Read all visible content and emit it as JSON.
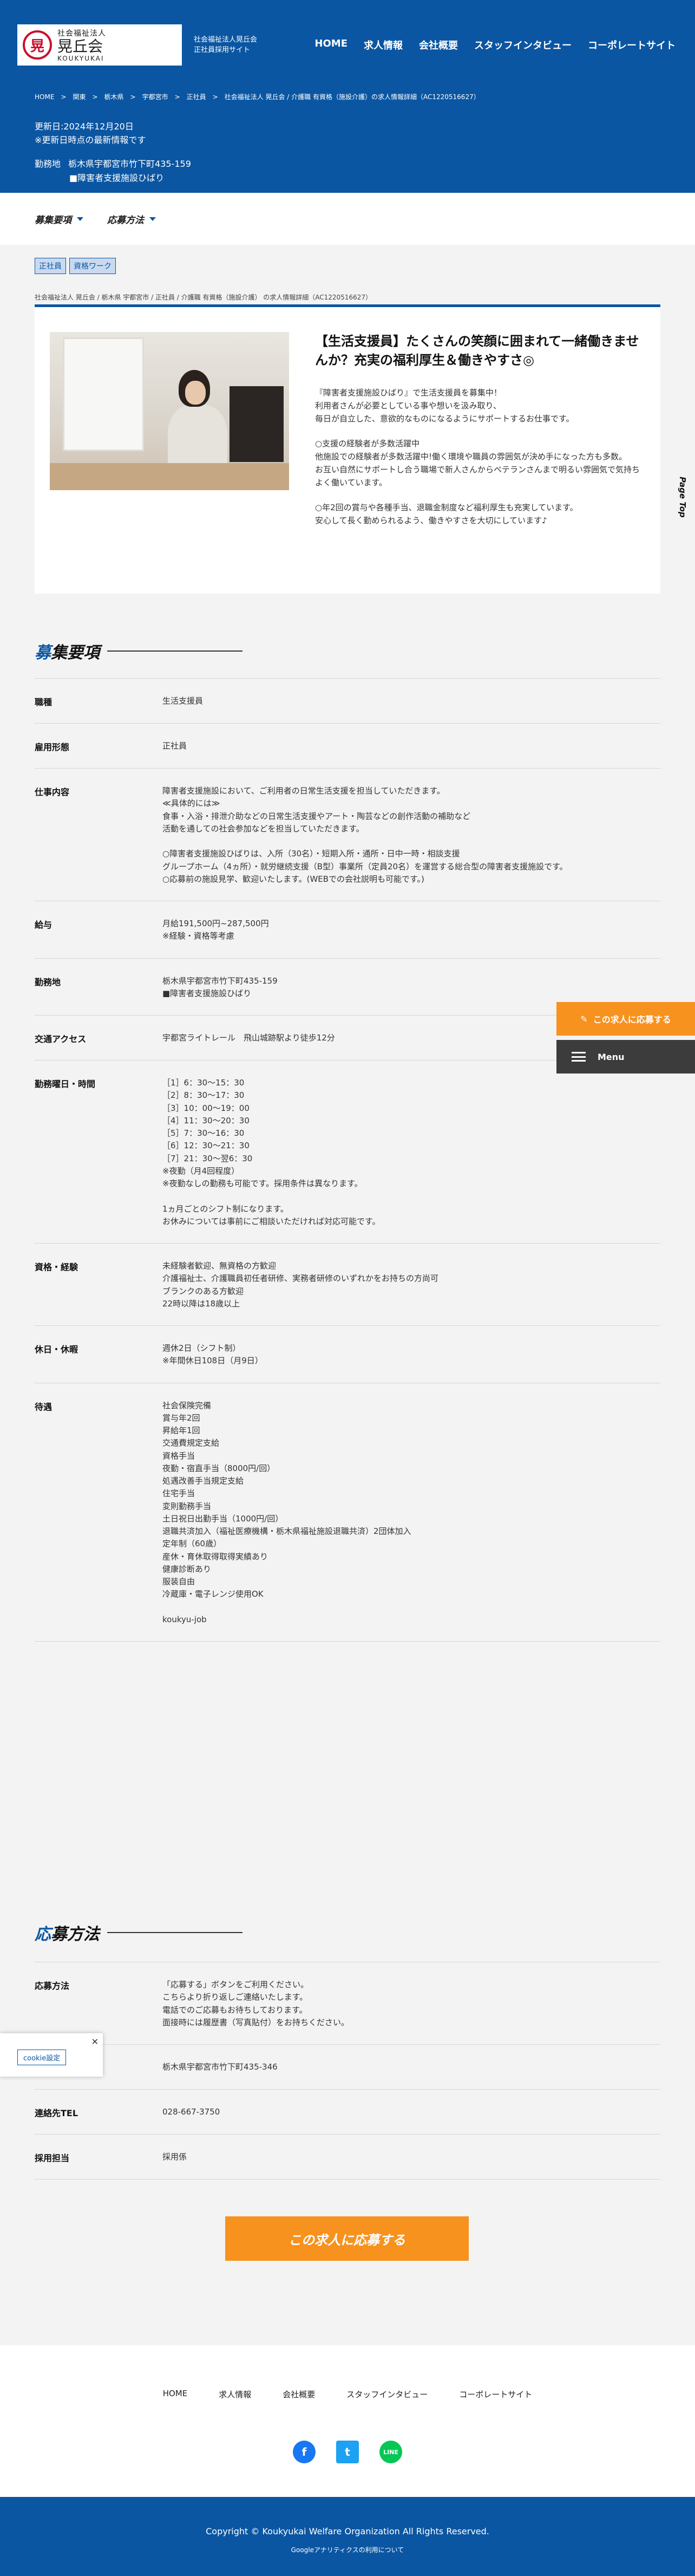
{
  "header": {
    "logo": {
      "mark": "晃",
      "top": "社会福祉法人",
      "main": "晃丘会",
      "sub": "KOUKYUKAI"
    },
    "site_sub": "社会福祉法人晃丘会\n正社員採用サイト",
    "nav": [
      "HOME",
      "求人情報",
      "会社概要",
      "スタッフインタビュー",
      "コーポレートサイト"
    ]
  },
  "breadcrumb_top": "HOME　>　関東　>　栃木県　>　宇都宮市　>　正社員　>　社会福祉法人 晃丘会 / 介護職 有資格（施設介護）の求人情報詳細（AC1220516627）",
  "updated": {
    "date": "更新日:2024年12月20日",
    "note": "※更新日時点の最新情報です"
  },
  "workplace_top": {
    "label": "勤務地",
    "address": "栃木県宇都宮市竹下町435-159",
    "facility": "■障害者支援施設ひばり"
  },
  "tabs": [
    "募集要項",
    "応募方法"
  ],
  "tags": [
    "正社員",
    "資格ワーク"
  ],
  "breadcrumb2": "社会福祉法人 晃丘会 / 栃木県 宇都宮市 / 正社員 / 介護職 有資格（施設介護） の求人情報詳細（AC1220516627）",
  "card": {
    "title": "【生活支援員】たくさんの笑顔に囲まれて一緒働きませんか？充実の福利厚生＆働きやすさ◎",
    "paragraphs": [
      "『障害者支援施設ひばり』で生活支援員を募集中！\n利用者さんが必要としている事や想いを汲み取り、\n毎日が自立した、意欲的なものになるようにサポートするお仕事です。",
      "○支援の経験者が多数活躍中\n他施設での経験者が多数活躍中!働く環境や職員の雰囲気が決め手になった方も多数。\nお互い自然にサポートし合う職場で新人さんからベテランさんまで明るい雰囲気で気持ちよく働いています。",
      "○年2回の賞与や各種手当、退職金制度など福利厚生も充実しています。\n安心して長く勤められるよう、働きやすさを大切にしています♪"
    ]
  },
  "sections": {
    "recruit_title_first": "募",
    "recruit_title_rest": "集要項",
    "apply_title_first": "応",
    "apply_title_rest": "募方法"
  },
  "recruit_rows": [
    {
      "label": "職種",
      "value": "生活支援員"
    },
    {
      "label": "雇用形態",
      "value": "正社員"
    },
    {
      "label": "仕事内容",
      "value": "障害者支援施設において、ご利用者の日常生活支援を担当していただきます。\n≪具体的には≫\n食事・入浴・排泄介助などの日常生活支援やアート・陶芸などの創作活動の補助など\n活動を通しての社会参加などを担当していただきます。\n\n○障害者支援施設ひばりは、入所（30名）・短期入所・通所・日中一時・相談支援\nグループホーム（4ヵ所）・就労継続支援（B型）事業所（定員20名）を運営する総合型の障害者支援施設です。\n○応募前の施設見学、歓迎いたします。(WEBでの会社説明も可能です。)"
    },
    {
      "label": "給与",
      "value": "月給191,500円~287,500円\n※経験・資格等考慮"
    },
    {
      "label": "勤務地",
      "value": "栃木県宇都宮市竹下町435-159\n■障害者支援施設ひばり"
    },
    {
      "label": "交通アクセス",
      "value": "宇都宮ライトレール　飛山城跡駅より徒歩12分"
    },
    {
      "label": "勤務曜日・時間",
      "value": "［1］6：30〜15：30\n［2］8：30〜17：30\n［3］10：00〜19：00\n［4］11：30〜20：30\n［5］7：30〜16：30\n［6］12：30〜21：30\n［7］21：30〜翌6：30\n※夜勤（月4回程度）\n※夜勤なしの勤務も可能です。採用条件は異なります。\n\n1ヵ月ごとのシフト制になります。\nお休みについては事前にご相談いただければ対応可能です。"
    },
    {
      "label": "資格・経験",
      "value": "未経験者歓迎、無資格の方歓迎\n介護福祉士、介護職員初任者研修、実務者研修のいずれかをお持ちの方尚可\nブランクのある方歓迎\n22時以降は18歳以上"
    },
    {
      "label": "休日・休暇",
      "value": "週休2日（シフト制）\n※年間休日108日（月9日）"
    },
    {
      "label": "待遇",
      "value": "社会保険完備\n賞与年2回\n昇給年1回\n交通費規定支給\n資格手当\n夜勤・宿直手当（8000円/回）\n処遇改善手当規定支給\n住宅手当\n変則勤務手当\n土日祝日出勤手当（1000円/回）\n退職共済加入（福祉医療機構・栃木県福祉施設退職共済）2団体加入\n定年制（60歳）\n産休・育休取得取得実績あり\n健康診断あり\n服装自由\n冷蔵庫・電子レンジ使用OK\n\nkoukyu-job"
    }
  ],
  "apply_rows": [
    {
      "label": "応募方法",
      "value": "「応募する」ボタンをご利用ください。\nこちらより折り返しご連絡いたします。\n電話でのご応募もお待ちしております。\n面接時には履歴書（写真貼付）をお持ちください。"
    },
    {
      "label": "連絡先住所",
      "value": "栃木県宇都宮市竹下町435-346"
    },
    {
      "label": "連絡先TEL",
      "value": "028-667-3750"
    },
    {
      "label": "採用担当",
      "value": "採用係"
    }
  ],
  "side": {
    "page_top": "Page Top",
    "apply": "この求人に応募する",
    "menu": "Menu"
  },
  "cookie": {
    "label": "cookie設定",
    "close": "✕"
  },
  "apply_button": "この求人に応募する",
  "footer": {
    "nav": [
      "HOME",
      "求人情報",
      "会社概要",
      "スタッフインタビュー",
      "コーポレートサイト"
    ],
    "sns": {
      "facebook": "f",
      "twitter": "t",
      "line": "LINE"
    },
    "copyright": "Copyright © Koukyukai Welfare Organization All Rights Reserved.",
    "analytics": "Googleアナリティクスの利用について"
  },
  "colors": {
    "brand_blue": "#0b56a2",
    "accent_orange": "#f7921e",
    "dark_gray": "#3c3c3c"
  }
}
